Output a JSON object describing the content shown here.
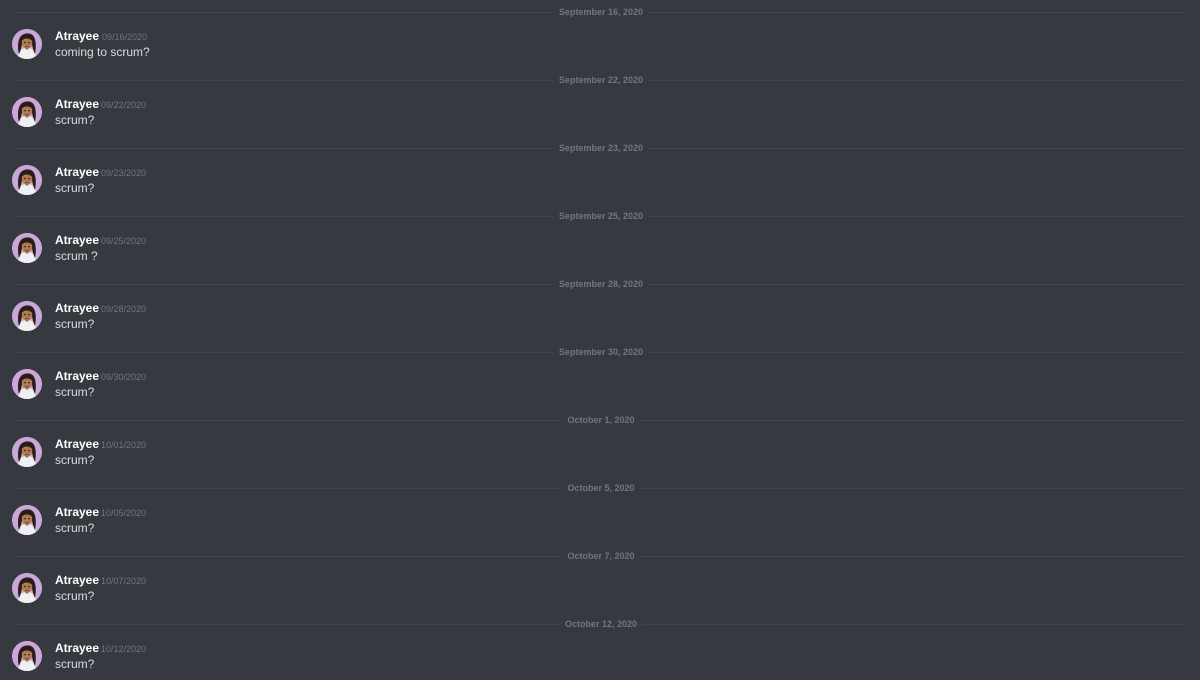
{
  "colors": {
    "background": "#36393f",
    "divider_line": "#42454a",
    "divider_text": "#72767d",
    "username": "#ffffff",
    "timestamp": "#72767d",
    "message_text": "#dcddde",
    "avatar_bg": "#c9a7d8"
  },
  "messages": [
    {
      "divider": "September 16, 2020",
      "author": "Atrayee",
      "timestamp": "09/16/2020",
      "text": "coming to scrum?",
      "avatar_icon": "user-avatar-icon"
    },
    {
      "divider": "September 22, 2020",
      "author": "Atrayee",
      "timestamp": "09/22/2020",
      "text": "scrum?",
      "avatar_icon": "user-avatar-icon"
    },
    {
      "divider": "September 23, 2020",
      "author": "Atrayee",
      "timestamp": "09/23/2020",
      "text": "scrum?",
      "avatar_icon": "user-avatar-icon"
    },
    {
      "divider": "September 25, 2020",
      "author": "Atrayee",
      "timestamp": "09/25/2020",
      "text": "scrum ?",
      "avatar_icon": "user-avatar-icon"
    },
    {
      "divider": "September 28, 2020",
      "author": "Atrayee",
      "timestamp": "09/28/2020",
      "text": "scrum?",
      "avatar_icon": "user-avatar-icon"
    },
    {
      "divider": "September 30, 2020",
      "author": "Atrayee",
      "timestamp": "09/30/2020",
      "text": "scrum?",
      "avatar_icon": "user-avatar-icon"
    },
    {
      "divider": "October 1, 2020",
      "author": "Atrayee",
      "timestamp": "10/01/2020",
      "text": "scrum?",
      "avatar_icon": "user-avatar-icon"
    },
    {
      "divider": "October 5, 2020",
      "author": "Atrayee",
      "timestamp": "10/05/2020",
      "text": "scrum?",
      "avatar_icon": "user-avatar-icon"
    },
    {
      "divider": "October 7, 2020",
      "author": "Atrayee",
      "timestamp": "10/07/2020",
      "text": "scrum?",
      "avatar_icon": "user-avatar-icon"
    },
    {
      "divider": "October 12, 2020",
      "author": "Atrayee",
      "timestamp": "10/12/2020",
      "text": "scrum?",
      "avatar_icon": "user-avatar-icon"
    }
  ]
}
